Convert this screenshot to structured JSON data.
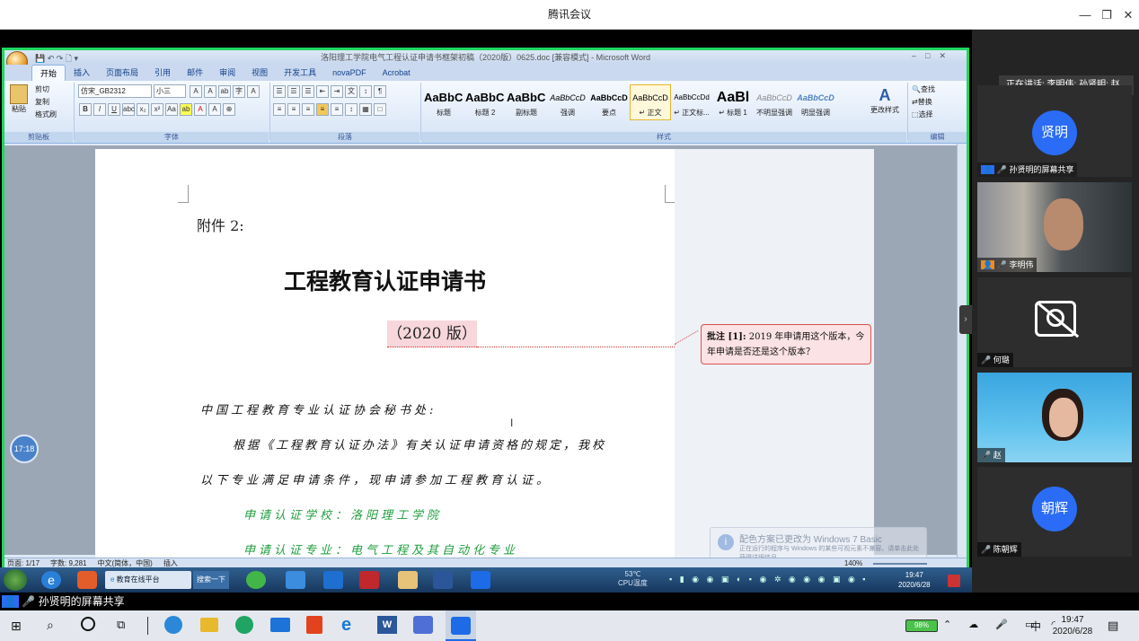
{
  "tencent": {
    "title": "腾讯会议"
  },
  "word": {
    "doc_title": "洛阳理工学院电气工程认证申请书框架初稿（2020版）0625.doc [兼容模式] - Microsoft Word",
    "tabs": [
      "开始",
      "插入",
      "页面布局",
      "引用",
      "邮件",
      "审阅",
      "视图",
      "开发工具",
      "novaPDF",
      "Acrobat"
    ],
    "clipboard": {
      "paste": "粘贴",
      "cut": "剪切",
      "copy": "复制",
      "format_painter": "格式刷",
      "label": "剪贴板"
    },
    "font": {
      "name": "仿宋_GB2312",
      "size": "小三",
      "label": "字体"
    },
    "paragraph": {
      "label": "段落"
    },
    "styles": {
      "label": "样式",
      "change": "更改样式",
      "items": [
        {
          "sample": "AaBbC(",
          "name": "标题"
        },
        {
          "sample": "AaBbC(",
          "name": "标题 2"
        },
        {
          "sample": "AaBbC(",
          "name": "副标题"
        },
        {
          "sample": "AaBbCcD",
          "name": "强调"
        },
        {
          "sample": "AaBbCcD",
          "name": "要点"
        },
        {
          "sample": "AaBbCcD",
          "name": "↵ 正文",
          "selected": true
        },
        {
          "sample": "AaBbCcDd",
          "name": "↵ 正文标..."
        },
        {
          "sample": "AaBl",
          "name": "↵ 标题 1"
        },
        {
          "sample": "AaBbCcD",
          "name": "不明显强调"
        },
        {
          "sample": "AaBbCcD",
          "name": "明显强调"
        }
      ]
    },
    "editing": {
      "find": "查找",
      "replace": "替换",
      "select": "选择",
      "label": "编辑"
    },
    "doc": {
      "attachment": "附件 2:",
      "heading": "工程教育认证申请书",
      "edition": "（2020 版）",
      "line1": "中国工程教育专业认证协会秘书处:",
      "line2": "根据《工程教育认证办法》有关认证申请资格的规定，我校",
      "line3": "以下专业满足申请条件，现申请参加工程教育认证。",
      "line4": "申请认证学校：洛阳理工学院",
      "line5": "申请认证专业：电气工程及其自动化专业"
    },
    "comment": {
      "label": "批注 [1]:",
      "text": "2019 年申请用这个版本，今年申请是否还是这个版本？"
    },
    "status": {
      "page": "页面: 1/17",
      "words": "字数: 9,281",
      "lang": "中文(简体，中国)",
      "mode": "插入",
      "zoom": "140%"
    },
    "notification": {
      "title": "配色方案已更改为 Windows 7 Basic",
      "body": "正在运行的程序与 Windows 的某些可视元素不兼容。请单击此处获得详细信息。"
    }
  },
  "inner_taskbar": {
    "app": "教育在线平台",
    "search": "搜索一下",
    "temp": "53℃",
    "temp_label": "CPU温度",
    "time": "19:47",
    "date": "2020/6/28"
  },
  "timer": "17:18",
  "panel": {
    "speaking": "正在讲话: 李明伟; 孙贤明; 赵",
    "participants": [
      {
        "avatar": "贤明",
        "name": "孙贤明的屏幕共享"
      },
      {
        "name": "李明伟"
      },
      {
        "name": "何璐"
      },
      {
        "name": "赵"
      },
      {
        "avatar": "朝辉",
        "name": "陈朝辉"
      }
    ]
  },
  "share_label": "孙贤明的屏幕共享",
  "win_taskbar": {
    "battery": "98%",
    "ime": "中",
    "time": "19:47",
    "date": "2020/6/28"
  }
}
